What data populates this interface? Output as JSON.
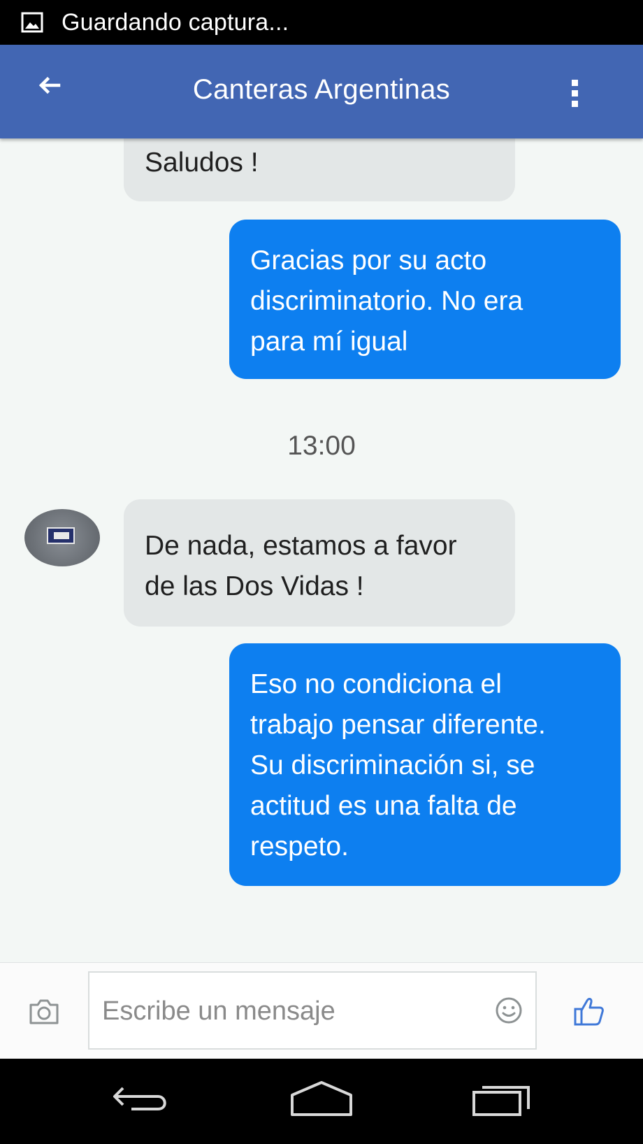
{
  "status_bar": {
    "text": "Guardando captura...",
    "icon": "image-icon"
  },
  "app_bar": {
    "title": "Canteras Argentinas",
    "back_icon": "back-arrow-icon",
    "menu_icon": "overflow-menu-icon"
  },
  "messages": [
    {
      "direction": "incoming",
      "lines": [
        "Saludos !"
      ]
    },
    {
      "direction": "outgoing",
      "lines": [
        "Gracias por su acto",
        "discriminatorio. No era",
        "para mí igual"
      ]
    },
    {
      "direction": "incoming",
      "lines": [
        "De nada, estamos a favor",
        "de las Dos Vidas !"
      ]
    },
    {
      "direction": "outgoing",
      "lines": [
        "Eso no condiciona el",
        "trabajo pensar diferente.",
        "Su discriminación si, se",
        "actitud es una falta de",
        "respeto."
      ]
    }
  ],
  "timestamp": "13:00",
  "input_bar": {
    "placeholder": "Escribe un mensaje",
    "camera_icon": "camera-icon",
    "emoji_icon": "emoji-icon",
    "like_icon": "thumbs-up-icon"
  },
  "nav_bar": {
    "back_icon": "nav-back-icon",
    "home_icon": "nav-home-icon",
    "recents_icon": "nav-recents-icon"
  },
  "colors": {
    "app_bar": "#4266b3",
    "outgoing_bubble": "#0d7ff0",
    "incoming_bubble": "#e3e7e7",
    "chat_background": "#f3f7f5"
  }
}
